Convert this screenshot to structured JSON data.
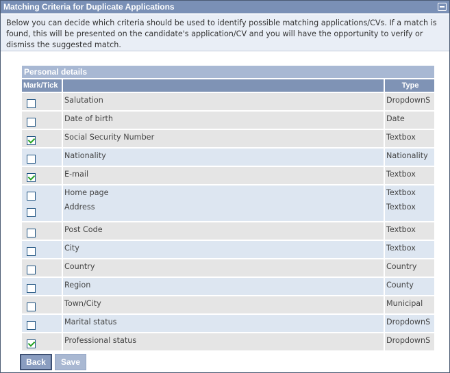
{
  "panel": {
    "title": "Matching Criteria for Duplicate Applications",
    "intro": "Below you can decide which criteria should be used to identify possible matching applications/CVs. If a match is found, this will be presented on the candidate's application/CV and you will have the opportunity to verify or dismiss the suggested match."
  },
  "table": {
    "section_title": "Personal details",
    "col_mark": "Mark/Tick",
    "col_type": "Type"
  },
  "criteria": [
    {
      "label": "Salutation",
      "type": "DropdownS",
      "checked": false
    },
    {
      "label": "Date of birth",
      "type": "Date",
      "checked": false
    },
    {
      "label": "Social Security Number",
      "type": "Textbox",
      "checked": true
    },
    {
      "label": "Nationality",
      "type": "Nationality",
      "checked": false
    },
    {
      "label": "E-mail",
      "type": "Textbox",
      "checked": true
    },
    {
      "label": "Home page",
      "type": "Textbox",
      "checked": false
    },
    {
      "label": "Address",
      "type": "Textbox",
      "checked": false
    },
    {
      "label": "Post Code",
      "type": "Textbox",
      "checked": false
    },
    {
      "label": "City",
      "type": "Textbox",
      "checked": false
    },
    {
      "label": "Country",
      "type": "Country",
      "checked": false
    },
    {
      "label": "Region",
      "type": "County",
      "checked": false
    },
    {
      "label": "Town/City",
      "type": "Municipal",
      "checked": false
    },
    {
      "label": "Marital status",
      "type": "DropdownS",
      "checked": false
    },
    {
      "label": "Professional status",
      "type": "DropdownS",
      "checked": true
    }
  ],
  "buttons": {
    "back": "Back",
    "save": "Save"
  },
  "colors": {
    "title_bar": "#7a90b6",
    "section_header": "#a8b8d3",
    "column_header": "#7f93b5",
    "row_grey": "#e5e5e5",
    "row_blue": "#dde6f1",
    "check_green": "#21a121"
  },
  "icons": {
    "collapse": "collapse-minus-icon",
    "checkbox": "checkbox-icon"
  }
}
